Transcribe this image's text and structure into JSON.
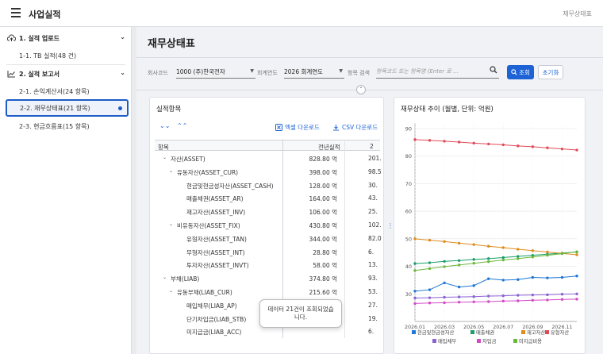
{
  "app": {
    "title": "사업실적",
    "crumb": "재무상태표"
  },
  "sidebar": {
    "groups": [
      {
        "label": "1. 실적 업로드",
        "items": [
          {
            "label": "1-1. TB 실적(48 건)"
          }
        ]
      },
      {
        "label": "2. 실적 보고서",
        "items": [
          {
            "label": "2-1. 손익계산서(24 항목)"
          },
          {
            "label": "2-2. 재무상태표(21 항목)"
          },
          {
            "label": "2-3. 현금흐름표(15 항목)"
          }
        ]
      }
    ]
  },
  "page": {
    "title": "재무상태표"
  },
  "filters": {
    "company_label": "회사코드",
    "company_value": "1000 (주)한국전자",
    "year_label": "회계연도",
    "year_value": "2026 회계연도",
    "search_label": "항목 검색",
    "search_placeholder": "항목코드 또는 항목명 (Enter 로 ...",
    "search_button": "조회",
    "reset_button": "초기화"
  },
  "grid": {
    "title": "실적항목",
    "excel_download": "엑셀 다운로드",
    "csv_download": "CSV 다운로드",
    "columns": [
      "항목",
      "전년실적",
      "2"
    ],
    "rows": [
      {
        "name": "자산(ASSET)",
        "prev": "828.80 억",
        "cur": "201."
      },
      {
        "name": "유동자산(ASSET_CUR)",
        "prev": "398.00 억",
        "cur": "98.5"
      },
      {
        "name": "현금및현금성자산(ASSET_CASH)",
        "prev": "128.00 억",
        "cur": "30."
      },
      {
        "name": "매출채권(ASSET_AR)",
        "prev": "164.00 억",
        "cur": "43."
      },
      {
        "name": "재고자산(ASSET_INV)",
        "prev": "106.00 억",
        "cur": "25."
      },
      {
        "name": "비유동자산(ASSET_FIX)",
        "prev": "430.80 억",
        "cur": "102."
      },
      {
        "name": "유형자산(ASSET_TAN)",
        "prev": "344.00 억",
        "cur": "82.0"
      },
      {
        "name": "무형자산(ASSET_INT)",
        "prev": "28.80 억",
        "cur": "6."
      },
      {
        "name": "투자자산(ASSET_INVT)",
        "prev": "58.00 억",
        "cur": "13."
      },
      {
        "name": "부채(LIAB)",
        "prev": "374.80 억",
        "cur": "93."
      },
      {
        "name": "유동부채(LIAB_CUR)",
        "prev": "215.60 억",
        "cur": "53."
      },
      {
        "name": "매입채무(LIAB_AP)",
        "prev": "114.00 억",
        "cur": "27."
      },
      {
        "name": "단기차입금(LIAB_STB)",
        "prev": "",
        "cur": "19."
      },
      {
        "name": "미지급금(LIAB_ACC)",
        "prev": "",
        "cur": "6."
      }
    ]
  },
  "toast": {
    "message": "데이터 21건이 조회되었습니다."
  },
  "chart_title": "재무상태 추이 (월별, 단위: 억원)",
  "chart_data": {
    "type": "line",
    "title": "재무상태 추이 (월별, 단위: 억원)",
    "x": [
      "2026.01",
      "2026.02",
      "2026.03",
      "2026.04",
      "2026.05",
      "2026.06",
      "2026.07",
      "2026.08",
      "2026.09",
      "2026.10",
      "2026.11",
      "2026.12"
    ],
    "x_ticks": [
      "2026.01",
      "2026.03",
      "2026.05",
      "2026.07",
      "2026.09",
      "2026.11"
    ],
    "ylim": [
      20,
      92
    ],
    "y_ticks": [
      30,
      40,
      50,
      60,
      70,
      80,
      90
    ],
    "grid": true,
    "legend": "bottom",
    "series": [
      {
        "name": "현금및현금성자산",
        "color": "#1f77d6",
        "values": [
          31,
          31.5,
          34,
          32.5,
          33,
          35.5,
          35,
          35.2,
          36,
          35.8,
          36,
          36.5
        ]
      },
      {
        "name": "매출채권",
        "color": "#1a9e6a",
        "values": [
          41,
          41.3,
          41.8,
          42.1,
          42.5,
          42.8,
          43.2,
          43.6,
          44.0,
          44.4,
          44.8,
          45.2
        ]
      },
      {
        "name": "재고자산",
        "color": "#e08a1e",
        "values": [
          50,
          49.5,
          49,
          48.4,
          47.9,
          47.3,
          46.8,
          46.2,
          45.7,
          45.2,
          44.7,
          44.2
        ]
      },
      {
        "name": "유형자산",
        "color": "#e04a58",
        "values": [
          86,
          85.7,
          85.4,
          85.1,
          84.7,
          84.4,
          84.1,
          83.7,
          83.4,
          83.0,
          82.6,
          82.2
        ]
      },
      {
        "name": "매입채무",
        "color": "#8a63d2",
        "values": [
          28.5,
          28.6,
          28.8,
          28.9,
          29.0,
          29.2,
          29.3,
          29.5,
          29.6,
          29.7,
          29.9,
          30.0
        ]
      },
      {
        "name": "차입금",
        "color": "#d24ac6",
        "values": [
          26.5,
          26.7,
          26.8,
          27.0,
          27.1,
          27.2,
          27.4,
          27.5,
          27.7,
          27.8,
          28.0,
          28.1
        ]
      },
      {
        "name": "미지급비용",
        "color": "#6ab83a",
        "values": [
          38.5,
          39.2,
          39.9,
          40.5,
          41.1,
          41.7,
          42.3,
          42.8,
          43.4,
          44.0,
          44.6,
          45.3
        ]
      }
    ]
  }
}
